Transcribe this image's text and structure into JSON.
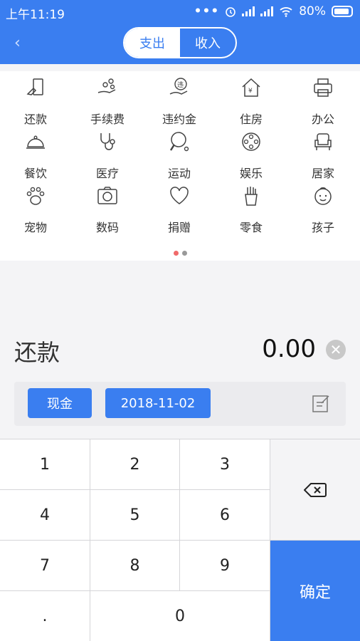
{
  "status_bar": {
    "time": "上午11:19",
    "battery": "80%"
  },
  "header": {
    "tabs": [
      {
        "label": "支出",
        "active": true
      },
      {
        "label": "收入",
        "active": false
      }
    ]
  },
  "categories": [
    {
      "label": "还款",
      "icon": "repayment-icon"
    },
    {
      "label": "手续费",
      "icon": "fee-icon"
    },
    {
      "label": "违约金",
      "icon": "penalty-icon"
    },
    {
      "label": "住房",
      "icon": "house-icon"
    },
    {
      "label": "办公",
      "icon": "printer-icon"
    },
    {
      "label": "餐饮",
      "icon": "dining-icon"
    },
    {
      "label": "医疗",
      "icon": "stethoscope-icon"
    },
    {
      "label": "运动",
      "icon": "pingpong-icon"
    },
    {
      "label": "娱乐",
      "icon": "film-reel-icon"
    },
    {
      "label": "居家",
      "icon": "armchair-icon"
    },
    {
      "label": "宠物",
      "icon": "paw-icon"
    },
    {
      "label": "数码",
      "icon": "camera-icon"
    },
    {
      "label": "捐赠",
      "icon": "heart-icon"
    },
    {
      "label": "零食",
      "icon": "fries-icon"
    },
    {
      "label": "孩子",
      "icon": "baby-icon"
    }
  ],
  "pager": {
    "pages": 2,
    "current": 1
  },
  "entry": {
    "category": "还款",
    "amount": "0.00",
    "account": "现金",
    "date": "2018-11-02"
  },
  "keypad": {
    "keys": [
      "1",
      "2",
      "3",
      "4",
      "5",
      "6",
      "7",
      "8",
      "9",
      ".",
      "0"
    ],
    "confirm": "确定"
  },
  "colors": {
    "accent": "#3a7ef0",
    "pager_active": "#f06a6a"
  }
}
